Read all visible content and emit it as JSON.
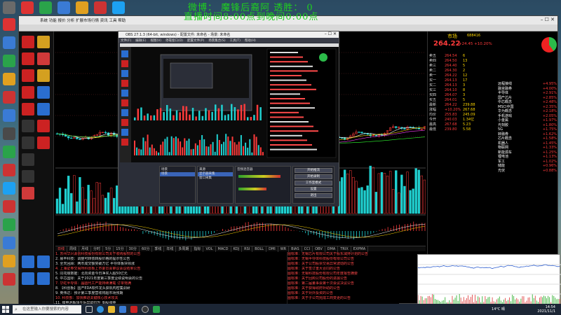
{
  "overlay": {
    "line1": "微博：  魔锋后裔阿      透胜：  0",
    "line2": "直播时间8:00点到晚间0:00点"
  },
  "trading_app": {
    "menu": "系统 功能 报价 分析 扩展市场行情 资讯 工具 帮助",
    "stock_name": "市场",
    "stock_code": "688416",
    "price": "264.22",
    "change": "+24.45 +10.20%",
    "quote_rows": [
      {
        "label": "卖五",
        "price": "264.54",
        "vol": "6"
      },
      {
        "label": "卖四",
        "price": "264.50",
        "vol": "13"
      },
      {
        "label": "卖三",
        "price": "264.40",
        "vol": "5"
      },
      {
        "label": "卖二",
        "price": "264.30",
        "vol": "2"
      },
      {
        "label": "卖一",
        "price": "264.22",
        "vol": "12"
      },
      {
        "label": "买一",
        "price": "264.13",
        "vol": "17"
      },
      {
        "label": "买二",
        "price": "264.13",
        "vol": "3"
      },
      {
        "label": "买三",
        "price": "264.10",
        "vol": "8"
      },
      {
        "label": "买四",
        "price": "264.07",
        "vol": "3"
      },
      {
        "label": "买五",
        "price": "264.01",
        "vol": "5"
      },
      {
        "label": "最新",
        "price": "264.22",
        "vol": "239.88"
      },
      {
        "label": "涨幅",
        "price": "+10.20%",
        "vol": "267.68"
      },
      {
        "label": "均价",
        "price": "255.83",
        "vol": "245.09"
      },
      {
        "label": "今开",
        "price": "240.03",
        "vol": "1.34亿"
      },
      {
        "label": "最高",
        "price": "267.68",
        "vol": "5.23"
      },
      {
        "label": "最低",
        "price": "239.80",
        "vol": "5.58"
      }
    ],
    "sector_list": [
      {
        "name": "远程接线",
        "change": "+4.95%"
      },
      {
        "name": "融资融券",
        "change": "+4.00%"
      },
      {
        "name": "半导体",
        "change": "+2.91%"
      },
      {
        "name": "国产芯片",
        "change": "+2.85%"
      },
      {
        "name": "中芯概念",
        "change": "+2.48%"
      },
      {
        "name": "MSCI中国",
        "change": "+2.35%"
      },
      {
        "name": "华为概念",
        "change": "+2.18%"
      },
      {
        "name": "手机游戏",
        "change": "+2.05%"
      },
      {
        "name": "小金属",
        "change": "+1.97%"
      },
      {
        "name": "光刻胶",
        "change": "+1.80%"
      },
      {
        "name": "5G",
        "change": "+1.75%"
      },
      {
        "name": "转融券",
        "change": "+1.62%"
      },
      {
        "name": "芯片概念",
        "change": "+1.58%"
      },
      {
        "name": "机器人",
        "change": "+1.45%"
      },
      {
        "name": "物联网",
        "change": "+1.33%"
      },
      {
        "name": "新能源车",
        "change": "+1.25%"
      },
      {
        "name": "锂电池",
        "change": "+1.13%"
      },
      {
        "name": "军工",
        "change": "+1.02%"
      },
      {
        "name": "储能",
        "change": "+0.96%"
      },
      {
        "name": "光伏",
        "change": "+0.88%"
      }
    ],
    "chart_tabs": [
      "日线",
      "周线",
      "月线",
      "分时",
      "5分",
      "15分",
      "30分",
      "60分",
      "季线",
      "年线",
      "多周期",
      "指标",
      "VOL",
      "MACD",
      "KDJ",
      "RSI",
      "BOLL",
      "DMI",
      "WR",
      "BIAS",
      "CCI",
      "OBV",
      "DMA",
      "TRIX",
      "EXPMA"
    ],
    "news": [
      "1. 苏州华兴源创科技股份有限公司关于收购股权的公告",
      "2. 晨丰科技：调整可转债转股价格的提示性公告",
      "3. 全天回顾：两市成交额突破万亿 半导体板块领涨",
      "4. 上海证券交易所科创板上市委员会审议会议结果公告",
      "5. 同花顺数据：北向资金今日净买入超50亿元",
      "6. 中芯国际：关于2021年度第三季度业绩说明会的公告",
      "7. 华虹半导体：晶圆代工产能持续满载 订单饱满",
      "8. 【科创板】国产EDA软件龙头获机构密集调研",
      "9. 英伟达：预计第三季度营收将超市场预期",
      "10. 科技部：加快推进关键核心技术攻关",
      "11. 锂电池板块午后异动拉升 多股涨停"
    ],
    "news2": [
      "图标准：无锡芯片有限公司关于股东减持计划的公告",
      "图标准：无锡半导体科技股份有限公司公告",
      "图标准：关于公司股票交易异常波动的公告",
      "图标准：关于签订重大合同的公告",
      "图标准：无锡科技股份有限公司年度报告摘要",
      "图标准：关于回购公司股份的进展公告",
      "图标准：第二届董事会第十次会议决议公告",
      "图标准：关于获得政府补助的公告",
      "图标准：关于对外投资的公告",
      "图标准：关于子公司完成工商变更的公告"
    ]
  },
  "obs": {
    "title": "OBS 27.1.3 (64-bit, windows) - 配置文件: 未命名 - 场景: 未命名",
    "menu": [
      "文件(F)",
      "编辑(E)",
      "视图(V)",
      "停靠窗口(D)",
      "配置文件(P)",
      "场景集合(S)",
      "工具(T)",
      "帮助(H)"
    ],
    "scenes_title": "场景",
    "scenes": [
      "场景"
    ],
    "sources_title": "来源",
    "sources": [
      "显示器采集",
      "窗口采集"
    ],
    "mixer_title": "音频混音器",
    "controls": [
      "开始推流",
      "开始录制",
      "工作室模式",
      "设置",
      "退出"
    ]
  },
  "taskbar": {
    "search_placeholder": "在这里输入你要搜索的内容",
    "temp": "14°C 晴",
    "time": "14:54",
    "date": "2021/11/1"
  }
}
